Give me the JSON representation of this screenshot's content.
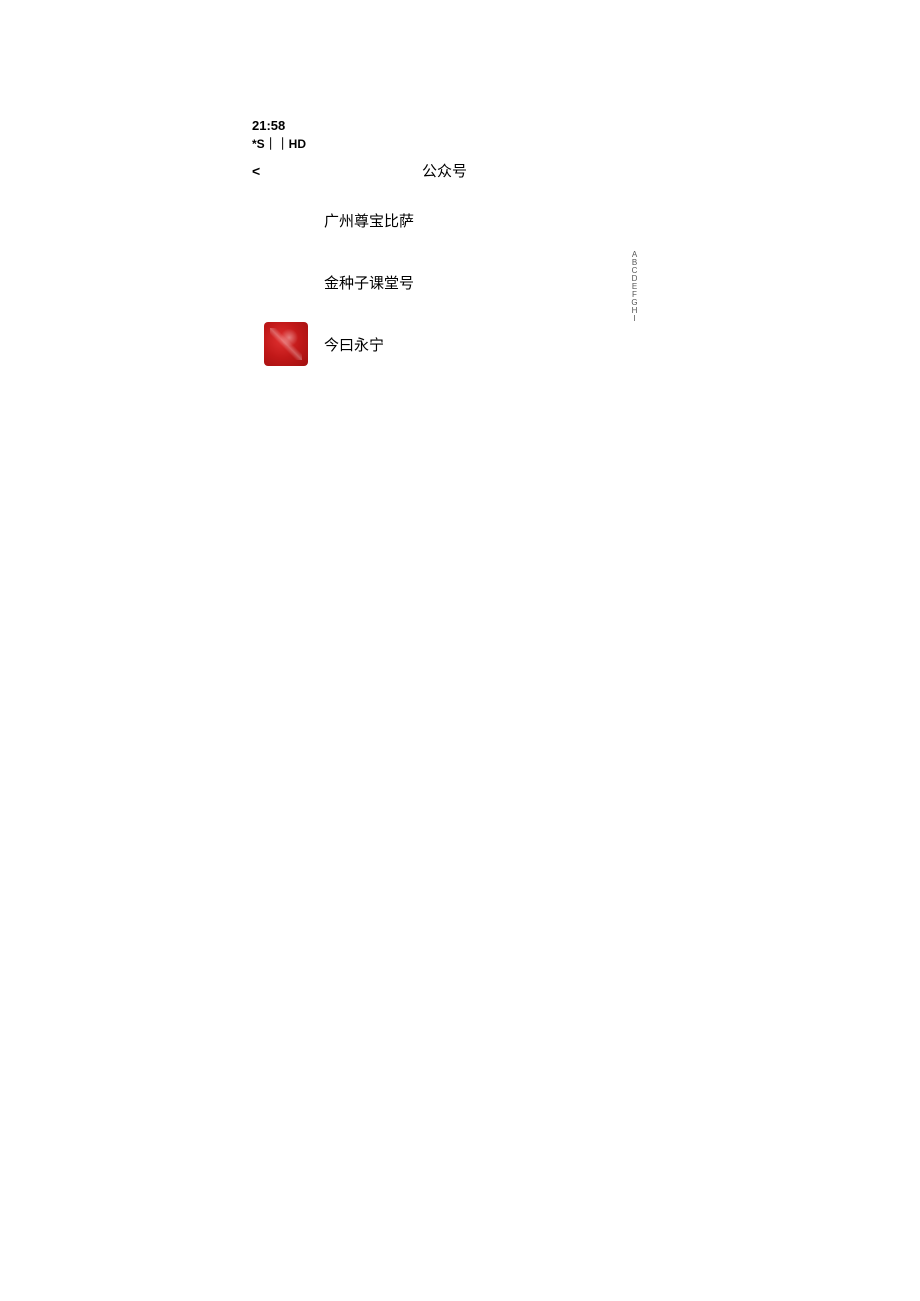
{
  "status": {
    "time": "21:58",
    "indicators": "*S｜｜HD"
  },
  "header": {
    "back": "<",
    "title": "公众号"
  },
  "list": [
    {
      "name": "广州尊宝比萨",
      "avatar": "placeholder"
    },
    {
      "name": "金种子课堂号",
      "avatar": "placeholder"
    },
    {
      "name": "今曰永宁",
      "avatar": "red"
    }
  ],
  "alpha_index": "ABCDEFGHI"
}
